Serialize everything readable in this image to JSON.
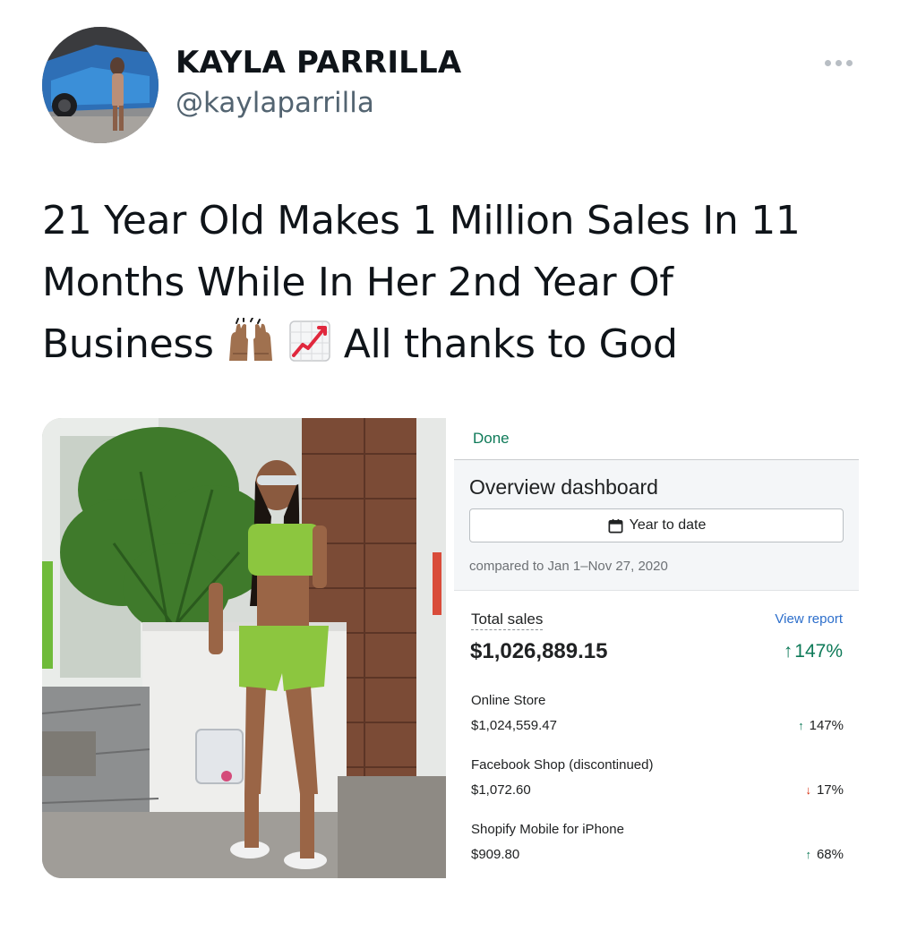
{
  "tweet": {
    "author_name": "KAYLA PARRILLA",
    "author_handle": "@kaylaparrilla",
    "text_line1": "21 Year Old Makes 1 Million Sales In 11",
    "text_line2": "Months While In Her 2nd Year Of",
    "text_line3_start": "Business",
    "text_line3_end": "All thanks to God",
    "emojis": [
      "raising-hands-emoji",
      "chart-increasing-emoji"
    ]
  },
  "dashboard": {
    "done_label": "Done",
    "title": "Overview dashboard",
    "date_range_label": "Year to date",
    "compare_text": "compared to Jan 1–Nov 27, 2020",
    "total": {
      "label": "Total sales",
      "view_report_label": "View report",
      "value": "$1,026,889.15",
      "change": "147%",
      "direction": "up"
    },
    "channels": [
      {
        "name": "Online Store",
        "value": "$1,024,559.47",
        "change": "147%",
        "direction": "up"
      },
      {
        "name": "Facebook Shop (discontinued)",
        "value": "$1,072.60",
        "change": "17%",
        "direction": "down"
      },
      {
        "name": "Shopify Mobile for iPhone",
        "value": "$909.80",
        "change": "68%",
        "direction": "up"
      }
    ]
  },
  "colors": {
    "positive": "#0e7a58",
    "negative": "#d72c0d",
    "link": "#2c6ecb",
    "handle": "#536471"
  },
  "icons": [
    "more-icon",
    "calendar-icon",
    "arrow-up-icon",
    "arrow-down-icon"
  ]
}
